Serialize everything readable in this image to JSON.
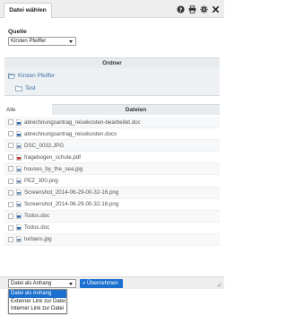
{
  "title_tab": "Datei wählen",
  "titlebar_icons": [
    "help-icon",
    "print-icon",
    "settings-icon",
    "close-icon"
  ],
  "quelle": {
    "label": "Quelle",
    "selected": "Kirsten Pfeiffer"
  },
  "ordner": {
    "header": "Ordner",
    "folders": [
      "Kirsten Pfeiffer",
      "Test"
    ]
  },
  "dateien": {
    "filter_label": "Alle",
    "header": "Dateien",
    "files": [
      {
        "name": "abrechnungsantrag_reisekosten-bearbeitet.doc",
        "type": "doc"
      },
      {
        "name": "abrechnungsantrag_reisekosten.docx",
        "type": "doc"
      },
      {
        "name": "DSC_0032.JPG",
        "type": "image"
      },
      {
        "name": "fragebogen_schule.pdf",
        "type": "pdf"
      },
      {
        "name": "houses_by_the_sea.jpg",
        "type": "image"
      },
      {
        "name": "PEZ_300.png",
        "type": "image"
      },
      {
        "name": "Screenshot_2014-06-29-00-32-16.png",
        "type": "image"
      },
      {
        "name": "Screenshot_2014-06-29-00-32-16.png",
        "type": "image"
      },
      {
        "name": "Todos.doc",
        "type": "doc"
      },
      {
        "name": "Todos.doc",
        "type": "doc"
      },
      {
        "name": "turbans.jpg",
        "type": "image"
      }
    ]
  },
  "footer": {
    "mode_selected": "Datei als Anhang",
    "submit_label": "» Übernehmen",
    "mode_options": [
      "Datei als Anhang",
      "Externer Link zur Datei",
      "Interner Link zur Datei"
    ]
  },
  "colors": {
    "accent": "#1a6fcf",
    "folder_text": "#3a6ea5",
    "doc_icon": "#2b6cb0",
    "image_icon": "#6b8fb5",
    "pdf_icon": "#c0392b"
  }
}
